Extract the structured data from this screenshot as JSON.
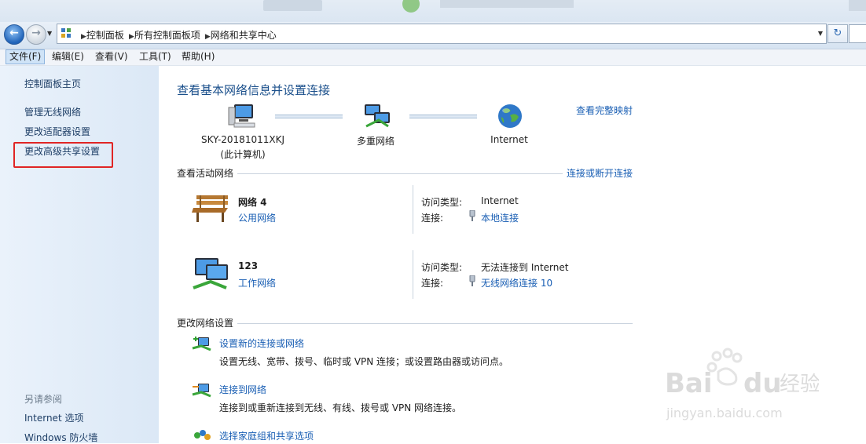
{
  "addressbar": {
    "crumbs": [
      "控制面板",
      "所有控制面板项",
      "网络和共享中心"
    ]
  },
  "menubar": {
    "items": [
      "文件(F)",
      "编辑(E)",
      "查看(V)",
      "工具(T)",
      "帮助(H)"
    ]
  },
  "sidebar": {
    "home": "控制面板主页",
    "links": [
      "管理无线网络",
      "更改适配器设置",
      "更改高级共享设置"
    ],
    "see_also_title": "另请参阅",
    "see_also": [
      "Internet 选项",
      "Windows 防火墙"
    ]
  },
  "main": {
    "title": "查看基本网络信息并设置连接",
    "view_full_map": "查看完整映射",
    "map": {
      "computer_name": "SKY-20181011XKJ",
      "computer_sub": "(此计算机)",
      "middle": "多重网络",
      "internet": "Internet"
    },
    "active_title": "查看活动网络",
    "connect_disconnect": "连接或断开连接",
    "networks": [
      {
        "name": "网络  4",
        "type": "公用网络",
        "access_label": "访问类型:",
        "access_value": "Internet",
        "conn_label": "连接:",
        "conn_value": "本地连接"
      },
      {
        "name": "123",
        "type": "工作网络",
        "access_label": "访问类型:",
        "access_value": "无法连接到 Internet",
        "conn_label": "连接:",
        "conn_value": "无线网络连接 10"
      }
    ],
    "change_title": "更改网络设置",
    "tasks": [
      {
        "title": "设置新的连接或网络",
        "desc": "设置无线、宽带、拨号、临时或 VPN 连接；或设置路由器或访问点。"
      },
      {
        "title": "连接到网络",
        "desc": "连接到或重新连接到无线、有线、拨号或 VPN 网络连接。"
      },
      {
        "title": "选择家庭组和共享选项",
        "desc": ""
      }
    ]
  },
  "colors": {
    "link": "#1a5fb4",
    "title": "#1a4f8b",
    "highlight_box": "#e02525"
  }
}
